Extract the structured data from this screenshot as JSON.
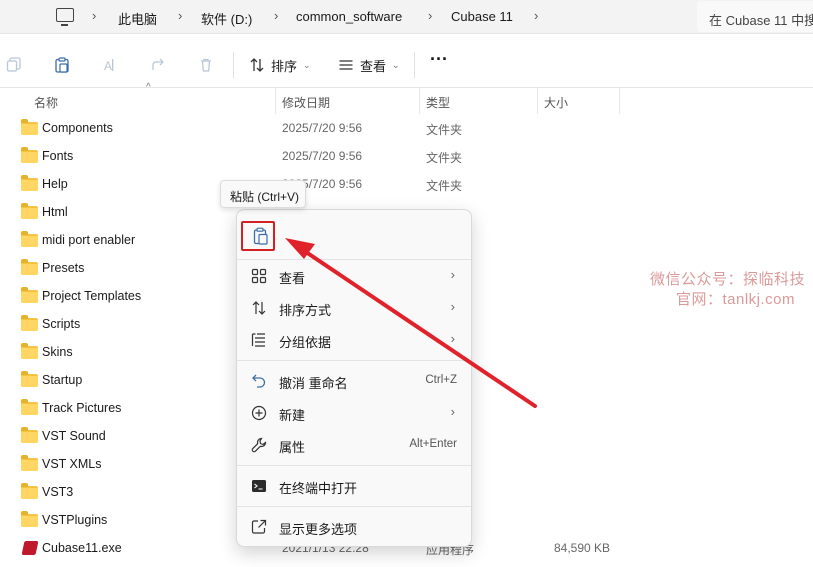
{
  "breadcrumb": {
    "items": [
      "此电脑",
      "软件 (D:)",
      "common_software",
      "Cubase 11"
    ],
    "separator": "›"
  },
  "search": {
    "placeholder": "在 Cubase 11 中搜"
  },
  "toolbar": {
    "sort_label": "排序",
    "view_label": "查看",
    "more_label": "···"
  },
  "columns": {
    "name": "名称",
    "date": "修改日期",
    "type": "类型",
    "size": "大小"
  },
  "files": [
    {
      "name": "Components",
      "date": "2025/7/20 9:56",
      "type": "文件夹",
      "size": ""
    },
    {
      "name": "Fonts",
      "date": "2025/7/20 9:56",
      "type": "文件夹",
      "size": ""
    },
    {
      "name": "Help",
      "date": "2025/7/20 9:56",
      "type": "文件夹",
      "size": ""
    },
    {
      "name": "Html",
      "date": "",
      "type": "",
      "size": ""
    },
    {
      "name": "midi port enabler",
      "date": "",
      "type": "",
      "size": ""
    },
    {
      "name": "Presets",
      "date": "",
      "type": "",
      "size": ""
    },
    {
      "name": "Project Templates",
      "date": "",
      "type": "",
      "size": ""
    },
    {
      "name": "Scripts",
      "date": "",
      "type": "",
      "size": ""
    },
    {
      "name": "Skins",
      "date": "",
      "type": "",
      "size": ""
    },
    {
      "name": "Startup",
      "date": "",
      "type": "",
      "size": ""
    },
    {
      "name": "Track Pictures",
      "date": "",
      "type": "",
      "size": ""
    },
    {
      "name": "VST Sound",
      "date": "",
      "type": "",
      "size": ""
    },
    {
      "name": "VST XMLs",
      "date": "",
      "type": "",
      "size": ""
    },
    {
      "name": "VST3",
      "date": "",
      "type": "",
      "size": ""
    },
    {
      "name": "VSTPlugins",
      "date": "",
      "type": "",
      "size": ""
    },
    {
      "name": "Cubase11.exe",
      "date": "2021/1/13 22:28",
      "type": "应用程序",
      "size": "84,590 KB"
    }
  ],
  "tooltip": "粘贴 (Ctrl+V)",
  "context_menu": {
    "items": [
      {
        "label": "查看",
        "shortcut": "",
        "arrow": "›"
      },
      {
        "label": "排序方式",
        "shortcut": "",
        "arrow": "›"
      },
      {
        "label": "分组依据",
        "shortcut": "",
        "arrow": "›"
      },
      {
        "label": "撤消 重命名",
        "shortcut": "Ctrl+Z",
        "arrow": ""
      },
      {
        "label": "新建",
        "shortcut": "",
        "arrow": "›"
      },
      {
        "label": "属性",
        "shortcut": "Alt+Enter",
        "arrow": ""
      },
      {
        "label": "在终端中打开",
        "shortcut": "",
        "arrow": ""
      },
      {
        "label": "显示更多选项",
        "shortcut": "",
        "arrow": ""
      }
    ]
  },
  "watermark": {
    "line1": "微信公众号：探临科技",
    "line2": "官网：tanlkj.com"
  },
  "colors": {
    "highlight": "#d32020",
    "arrow": "#e0222a",
    "folder": "#f4c341"
  }
}
